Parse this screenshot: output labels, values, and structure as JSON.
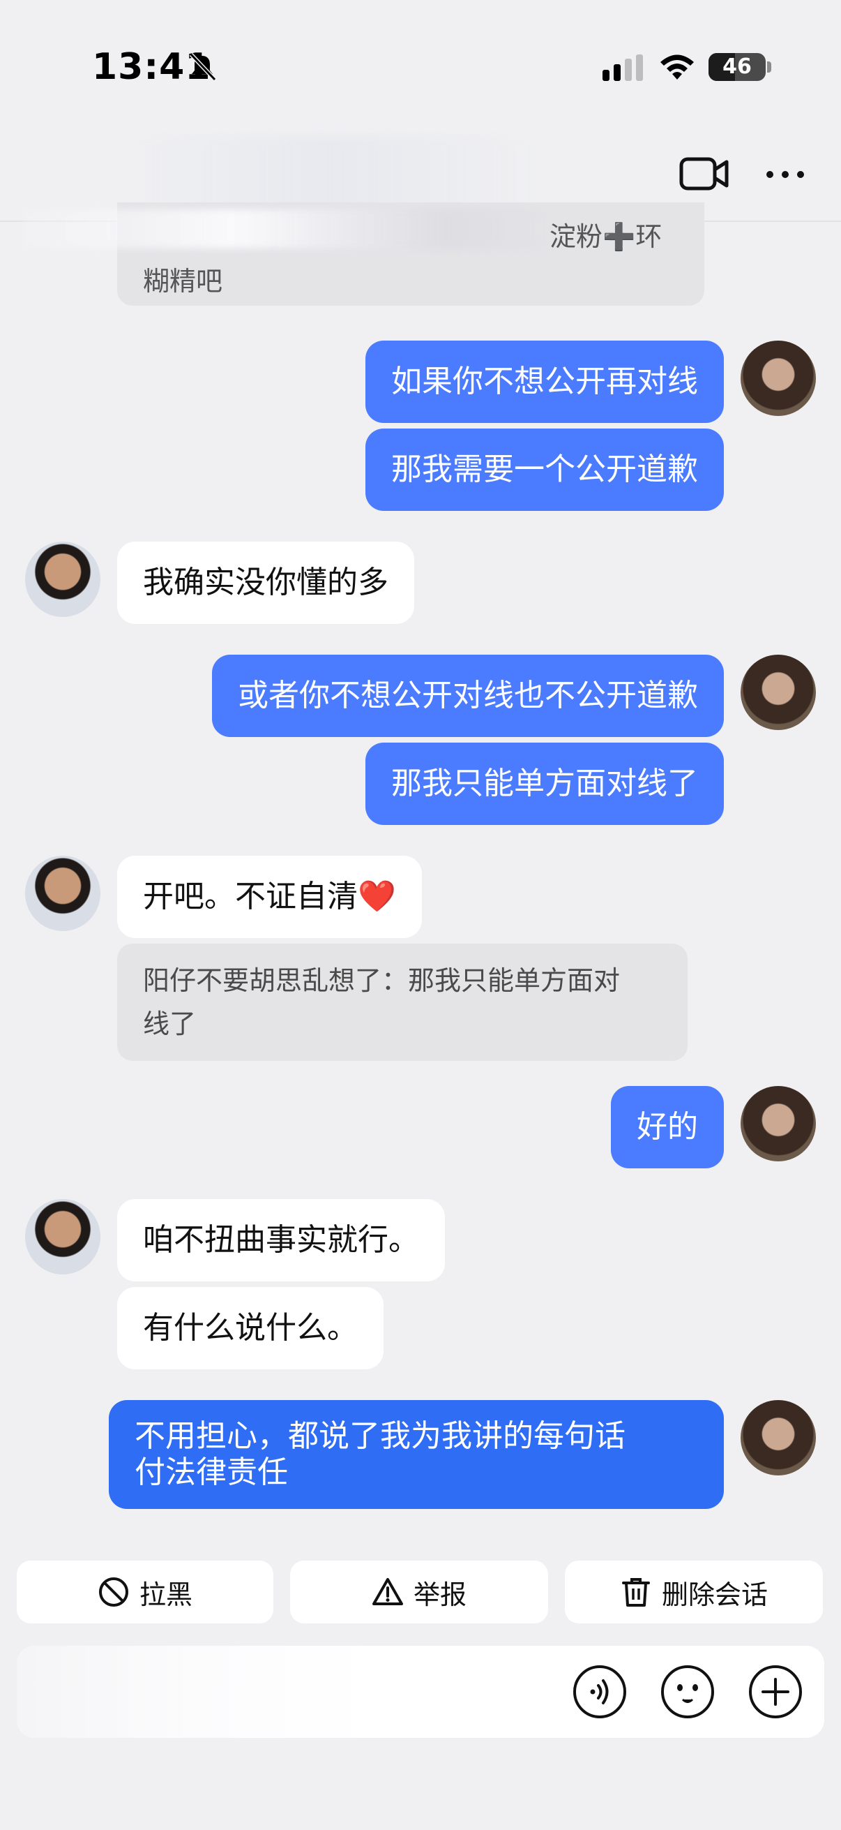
{
  "status_bar": {
    "time": "13:41",
    "battery": "46",
    "battery_level": 0.46
  },
  "header": {
    "video_call_icon": "video-camera-icon",
    "more_icon": "ellipsis-icon"
  },
  "messages": {
    "quote_top": {
      "line1": "淀粉➕环",
      "line2": "糊精吧"
    },
    "m1": "如果你不想公开再对线",
    "m2": "那我需要一个公开道歉",
    "m3": "我确实没你懂的多",
    "m4": "或者你不想公开对线也不公开道歉",
    "m5": "那我只能单方面对线了",
    "m6": "开吧。不证自清❤️",
    "quote2_line1": "阳仔不要胡思乱想了：那我只能单方面对",
    "quote2_line2": "线了",
    "m7": "好的",
    "m8": "咱不扭曲事实就行。",
    "m9": "有什么说什么。",
    "m10_line1": "不用担心，都说了我为我讲的每句话",
    "m10_line2": "付法律责任"
  },
  "actions": {
    "block": "拉黑",
    "report": "举报",
    "delete": "删除会话"
  },
  "input": {
    "voice_icon": "voice-icon",
    "emoji_icon": "emoji-icon",
    "plus_icon": "plus-icon"
  },
  "colors": {
    "outgoing": "#4b7bff",
    "incoming": "#ffffff",
    "background": "#f0f0f2"
  }
}
